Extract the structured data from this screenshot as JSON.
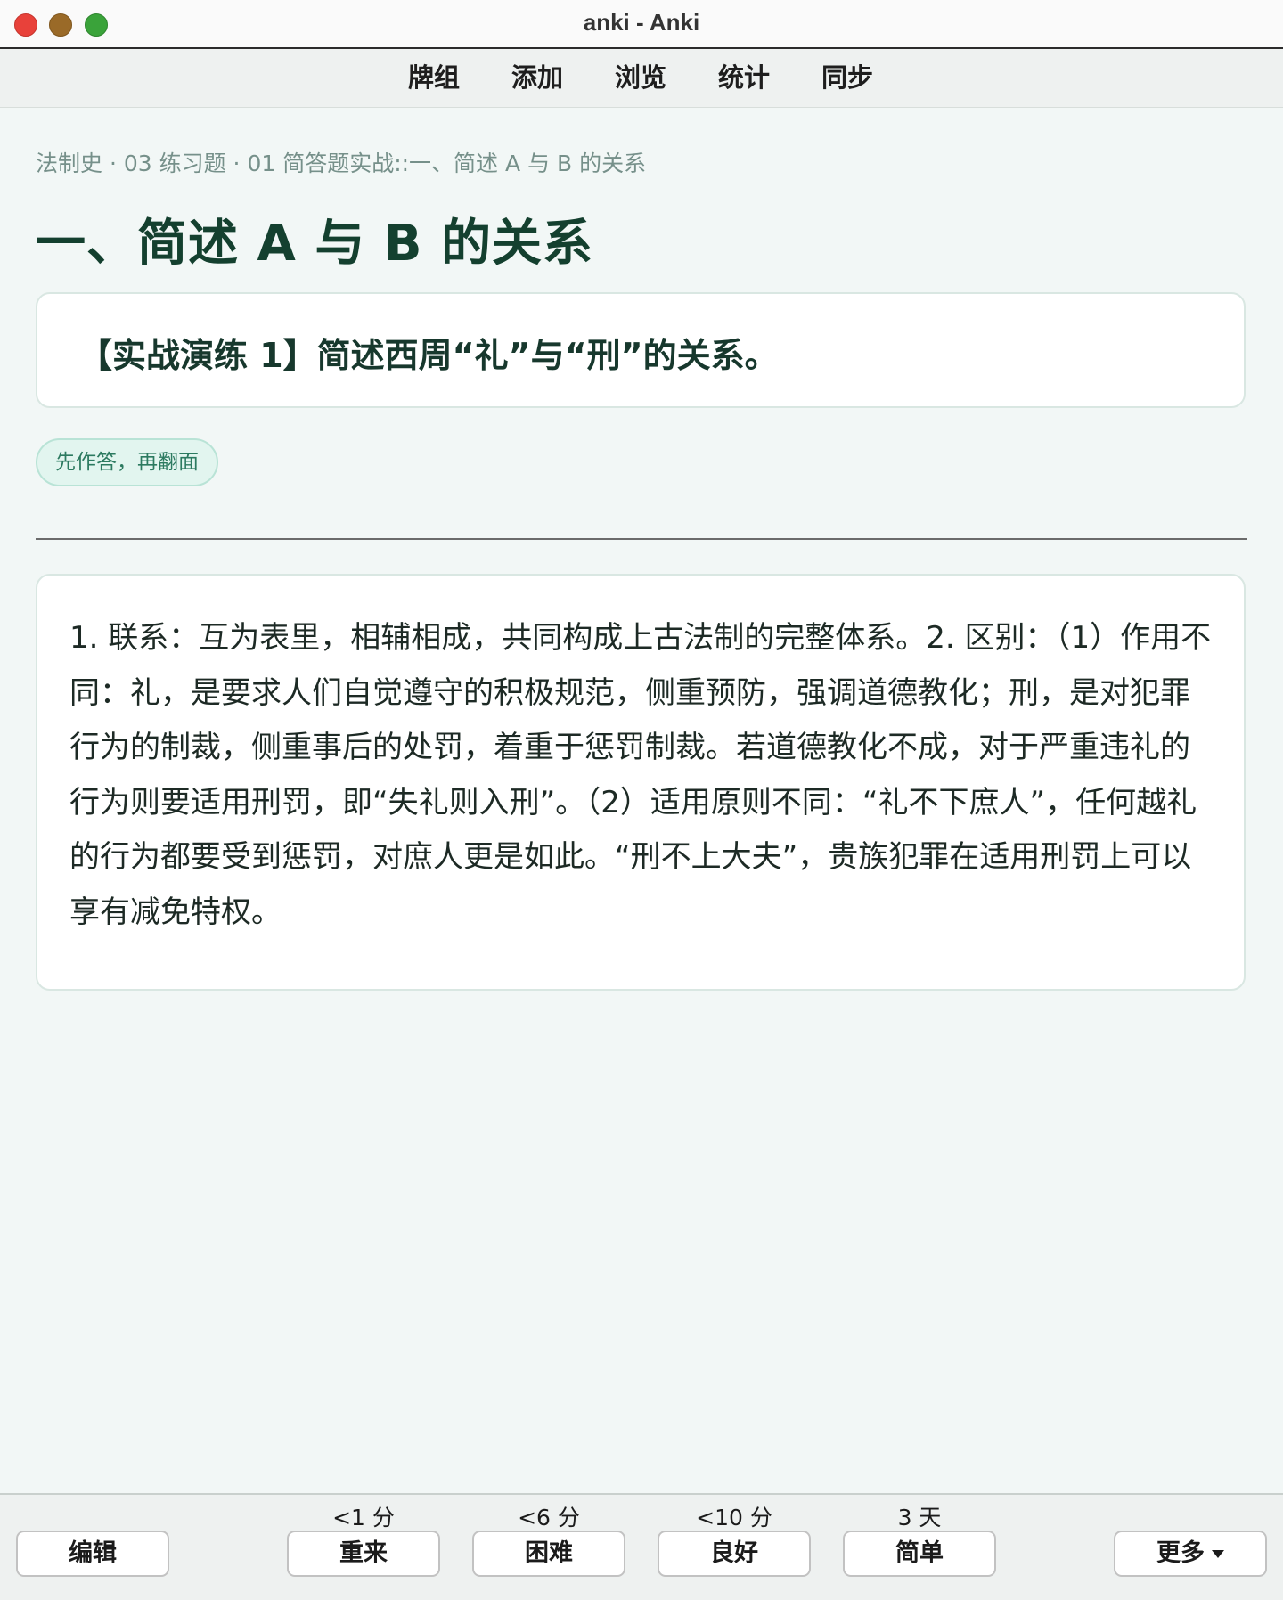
{
  "window": {
    "title": "anki - Anki"
  },
  "toolbar": {
    "items": [
      {
        "label": "牌组"
      },
      {
        "label": "添加"
      },
      {
        "label": "浏览"
      },
      {
        "label": "统计"
      },
      {
        "label": "同步"
      }
    ]
  },
  "card": {
    "deck_path": "法制史 · 03 练习题 · 01 简答题实战::一、简述 A 与 B 的关系",
    "heading": "一、简述 A 与 B 的关系",
    "question": "【实战演练 1】简述西周“礼”与“刑”的关系。",
    "hint": "先作答，再翻面",
    "answer": "1. 联系：互为表里，相辅相成，共同构成上古法制的完整体系。2. 区别：（1）作用不同：礼，是要求人们自觉遵守的积极规范，侧重预防，强调道德教化；刑，是对犯罪行为的制裁，侧重事后的处罚，着重于惩罚制裁。若道德教化不成，对于严重违礼的行为则要适用刑罚，即“失礼则入刑”。（2）适用原则不同：“礼不下庶人”，任何越礼的行为都要受到惩罚，对庶人更是如此。“刑不上大夫”，贵族犯罪在适用刑罚上可以享有减免特权。"
  },
  "bottom": {
    "edit_label": "编辑",
    "more_label": "更多",
    "answers": [
      {
        "interval": "<1 分",
        "label": "重来"
      },
      {
        "interval": "<6 分",
        "label": "困难"
      },
      {
        "interval": "<10 分",
        "label": "良好"
      },
      {
        "interval": "3 天",
        "label": "简单"
      }
    ]
  }
}
